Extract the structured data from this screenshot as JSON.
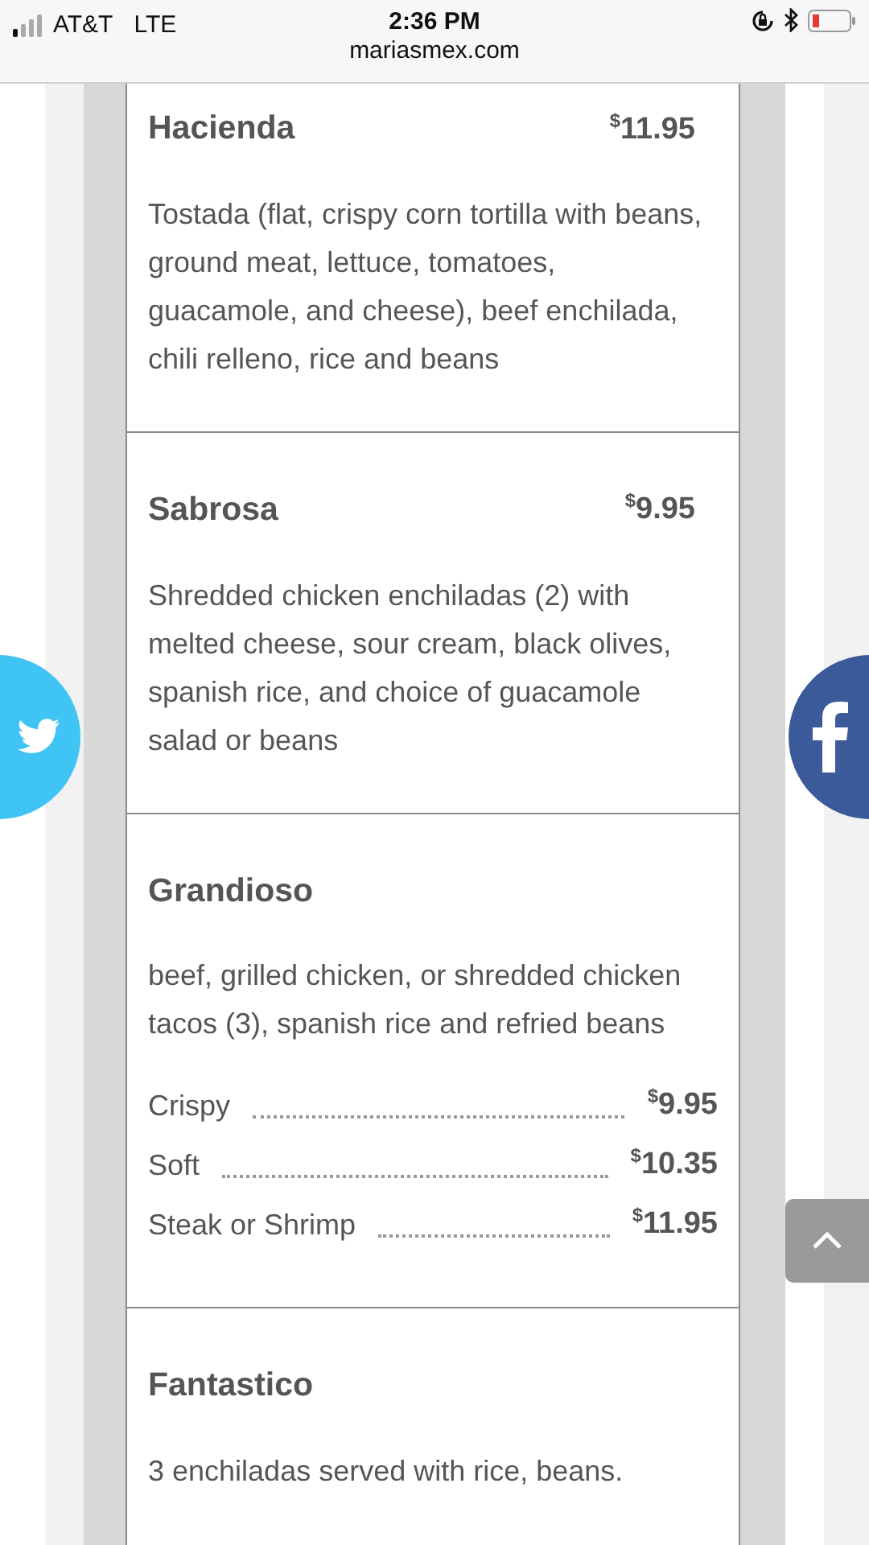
{
  "status_bar": {
    "carrier": "AT&T",
    "network": "LTE",
    "time": "2:36 PM",
    "url": "mariasmex.com"
  },
  "menu_items": [
    {
      "title": "Hacienda",
      "price": {
        "currency": "$",
        "amount": "11.95"
      },
      "description": "Tostada (flat, crispy corn tortilla with beans, ground meat, lettuce, tomatoes, guacamole, and cheese), beef enchilada, chili relleno, rice and beans"
    },
    {
      "title": "Sabrosa",
      "price": {
        "currency": "$",
        "amount": "9.95"
      },
      "description": "Shredded chicken enchiladas (2) with melted cheese, sour cream, black olives, spanish rice, and choice of guacamole salad or beans"
    },
    {
      "title": "Grandioso",
      "description": "beef, grilled chicken, or shredded chicken tacos (3), spanish rice and refried beans",
      "options": [
        {
          "label": "Crispy",
          "currency": "$",
          "amount": "9.95"
        },
        {
          "label": "Soft",
          "currency": "$",
          "amount": "10.35"
        },
        {
          "label": "Steak or Shrimp",
          "currency": "$",
          "amount": "11.95"
        }
      ]
    },
    {
      "title": "Fantastico",
      "description": "3 enchiladas served with rice, beans."
    }
  ]
}
